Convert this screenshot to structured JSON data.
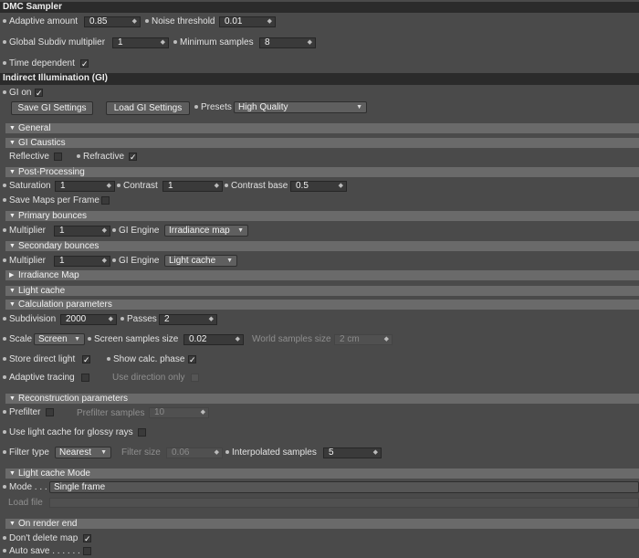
{
  "dmc": {
    "title": "DMC Sampler",
    "adaptive_amount_label": "Adaptive amount",
    "adaptive_amount": "0.85",
    "noise_threshold_label": "Noise threshold",
    "noise_threshold": "0.01",
    "global_subdiv_label": "Global Subdiv multiplier",
    "global_subdiv": "1",
    "min_samples_label": "Minimum samples",
    "min_samples": "8",
    "time_dependent_label": "Time dependent",
    "time_dependent": "✓"
  },
  "gi": {
    "title": "Indirect Illumination (GI)",
    "gi_on_label": "GI on",
    "gi_on": "✓",
    "save_settings": "Save GI Settings",
    "load_settings": "Load GI Settings",
    "presets_label": "Presets",
    "presets_value": "High Quality"
  },
  "general": {
    "title": "General",
    "caustics_title": "GI Caustics",
    "reflective_label": "Reflective",
    "reflective": "",
    "refractive_label": "Refractive",
    "refractive": "✓"
  },
  "post": {
    "title": "Post-Processing",
    "saturation_label": "Saturation",
    "saturation": "1",
    "contrast_label": "Contrast",
    "contrast": "1",
    "contrast_base_label": "Contrast base",
    "contrast_base": "0.5",
    "save_maps_label": "Save Maps per Frame",
    "save_maps": ""
  },
  "primary": {
    "title": "Primary bounces",
    "multiplier_label": "Multiplier",
    "multiplier": "1",
    "engine_label": "GI Engine",
    "engine": "Irradiance map"
  },
  "secondary": {
    "title": "Secondary bounces",
    "multiplier_label": "Multiplier",
    "multiplier": "1",
    "engine_label": "GI Engine",
    "engine": "Light cache"
  },
  "irradiance": {
    "title": "Irradiance Map"
  },
  "lightcache": {
    "title": "Light cache",
    "calc_title": "Calculation parameters",
    "subdivision_label": "Subdivision",
    "subdivision": "2000",
    "passes_label": "Passes",
    "passes": "2",
    "scale_label": "Scale",
    "scale": "Screen",
    "screen_samples_label": "Screen samples size",
    "screen_samples": "0.02",
    "world_samples_label": "World samples size",
    "world_samples": "2 cm",
    "store_direct_label": "Store direct light",
    "store_direct": "✓",
    "show_calc_label": "Show calc. phase",
    "show_calc": "✓",
    "adaptive_tracing_label": "Adaptive tracing",
    "adaptive_tracing": "",
    "use_direction_label": "Use direction only",
    "use_direction": ""
  },
  "recon": {
    "title": "Reconstruction parameters",
    "prefilter_label": "Prefilter",
    "prefilter": "",
    "prefilter_samples_label": "Prefilter samples",
    "prefilter_samples": "10",
    "glossy_label": "Use light cache for glossy rays",
    "glossy": "",
    "filter_type_label": "Filter type",
    "filter_type": "Nearest",
    "filter_size_label": "Filter size",
    "filter_size": "0.06",
    "interp_label": "Interpolated samples",
    "interp": "5"
  },
  "mode": {
    "title": "Light cache Mode",
    "mode_label": "Mode . . .",
    "mode_value": "Single frame",
    "load_file_label": "Load file"
  },
  "render_end": {
    "title": "On render end",
    "dont_delete_label": "Don't delete map",
    "dont_delete": "✓",
    "auto_save_label": "Auto save . . . . . . .",
    "auto_save": ""
  }
}
